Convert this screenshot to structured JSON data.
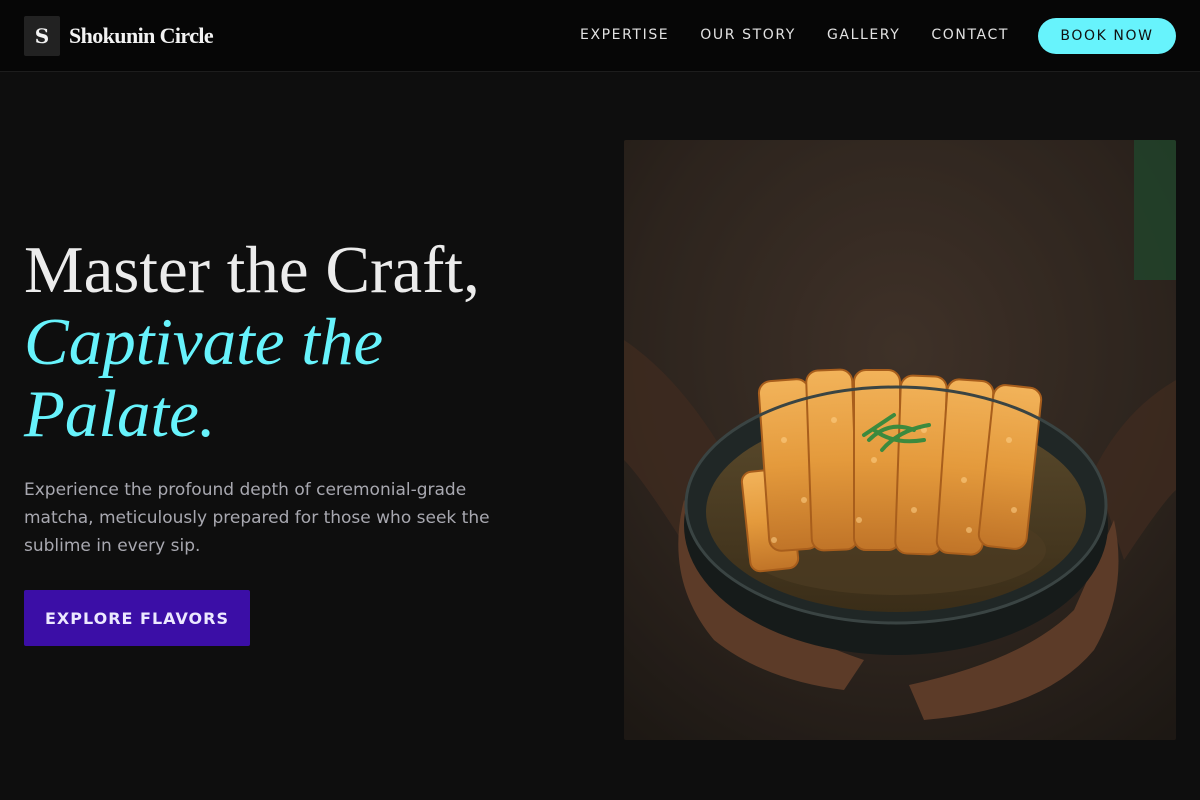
{
  "brand": {
    "logo_letter": "S",
    "name": "Shokunin Circle"
  },
  "nav": {
    "links": [
      "EXPERTISE",
      "OUR STORY",
      "GALLERY",
      "CONTACT"
    ],
    "cta_label": "BOOK NOW"
  },
  "hero": {
    "headline_line1": "Master the Craft,",
    "headline_accent": "Captivate the Palate.",
    "lead": "Experience the profound depth of ceremonial-grade matcha, meticulously prepared for those who seek the sublime in every sip.",
    "cta_label": "EXPLORE FLAVORS",
    "image_subject": "hands-holding-katsu-curry-bowl"
  },
  "colors": {
    "background": "#0e0e0e",
    "nav_background": "#060606",
    "accent": "#67f3fc",
    "cta_primary": "#3b0ea6",
    "muted_text": "#a8a8b0"
  }
}
